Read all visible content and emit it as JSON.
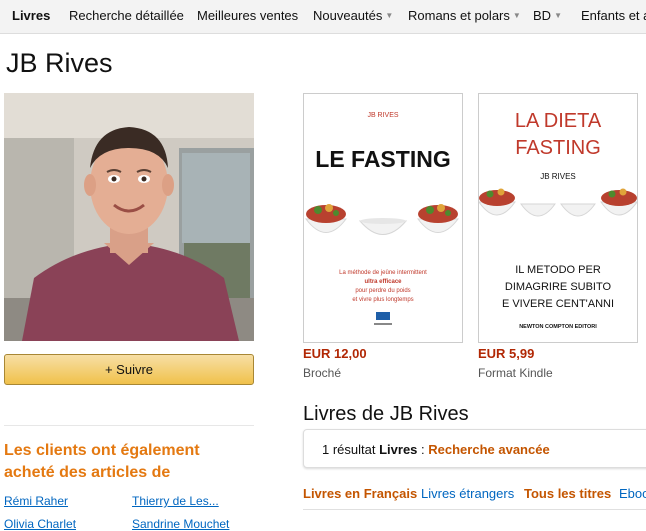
{
  "nav": {
    "items": [
      {
        "label": "Livres",
        "active": true
      },
      {
        "label": "Recherche détaillée"
      },
      {
        "label": "Meilleures ventes"
      },
      {
        "label": "Nouveautés",
        "dropdown": true
      },
      {
        "label": "Romans et polars",
        "dropdown": true
      },
      {
        "label": "BD",
        "dropdown": true
      },
      {
        "label": "Enfants et ad"
      }
    ]
  },
  "author": {
    "name": "JB Rives"
  },
  "follow_button": {
    "label": "+ Suivre"
  },
  "also_bought": {
    "title": "Les clients ont également acheté des articles de",
    "authors": [
      "Rémi Raher",
      "Thierry de Les...",
      "Olivia Charlet",
      "Sandrine Mouchet"
    ]
  },
  "books": [
    {
      "cover": {
        "author": "JB RIVES",
        "title": "LE FASTING",
        "tagline_lines": [
          "La méthode de jeûne intermittent",
          "ultra efficace",
          "pour perdre du poids",
          "et vivre plus longtemps"
        ]
      },
      "price": "EUR 12,00",
      "format": "Broché"
    },
    {
      "cover": {
        "title_lines": [
          "LA DIETA",
          "FASTING"
        ],
        "author": "JB RIVES",
        "subtitle_lines": [
          "IL METODO PER",
          "DIMAGRIRE SUBITO",
          "E VIVERE CENT'ANNI"
        ],
        "publisher": "NEWTON COMPTON EDITORI"
      },
      "price": "EUR 5,99",
      "format": "Format Kindle"
    }
  ],
  "books_section": {
    "heading": "Livres de JB Rives",
    "result_count": "1 résultat",
    "result_category": "Livres",
    "result_sep": " : ",
    "advanced_search": "Recherche avancée"
  },
  "language_tabs": [
    "Livres en Français",
    "Livres étrangers",
    "Tous les titres",
    "Ebooks"
  ],
  "colors": {
    "link": "#0066c0",
    "accent_orange": "#e47911",
    "price_red": "#b12704",
    "button_gold": "#f0c14b"
  }
}
